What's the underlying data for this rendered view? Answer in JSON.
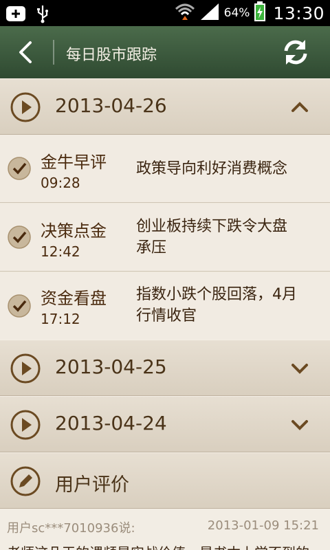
{
  "status_bar": {
    "battery_pct": "64%",
    "time": "13:30",
    "icons": [
      "add-notification-icon",
      "usb-icon",
      "wifi-icon",
      "signal-icon",
      "battery-charging-icon"
    ]
  },
  "header": {
    "title": "每日股市跟踪",
    "back_icon": "chevron-left-icon",
    "refresh_icon": "refresh-icon"
  },
  "days": [
    {
      "date": "2013-04-26",
      "expanded": true,
      "items": [
        {
          "category": "金牛早评",
          "time": "09:28",
          "headline_l1": "政策导向利好消费概念",
          "headline_l2": ""
        },
        {
          "category": "决策点金",
          "time": "12:42",
          "headline_l1": "创业板持续下跌令大盘",
          "headline_l2": "承压"
        },
        {
          "category": "资金看盘",
          "time": "17:12",
          "headline_l1": "指数小跌个股回落，4月",
          "headline_l2": "行情收官"
        }
      ]
    },
    {
      "date": "2013-04-25",
      "expanded": false
    },
    {
      "date": "2013-04-24",
      "expanded": false
    }
  ],
  "review": {
    "title": "用户评价",
    "icon": "pencil-icon",
    "comment": {
      "user": "用户sc***7010936说:",
      "date": "2013-01-09 15:21",
      "text": "老师这几天的课频是实战价值，是书本上学不到的"
    }
  },
  "colors": {
    "header_bg": "#3d5a3e",
    "accent_brown": "#6b4a22",
    "section_bg": "#ddd4c6",
    "item_bg": "#f1ebe2"
  }
}
